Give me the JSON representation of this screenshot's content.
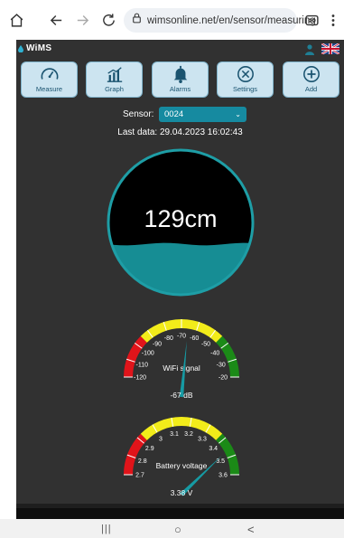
{
  "browser": {
    "url": "wimsonline.net/en/sensor/measuring",
    "icons": [
      "home-icon",
      "back-icon",
      "forward-icon",
      "reload-icon",
      "site-info-icon",
      "tab-switcher-icon",
      "more-menu-icon"
    ]
  },
  "app": {
    "logo": "WiMS",
    "nav": [
      {
        "label": "Measure",
        "icon": "gauge-icon"
      },
      {
        "label": "Graph",
        "icon": "bar-chart-icon"
      },
      {
        "label": "Alarms",
        "icon": "bell-icon"
      },
      {
        "label": "Settings",
        "icon": "tools-icon"
      },
      {
        "label": "Add",
        "icon": "plus-circle-icon"
      }
    ],
    "sensor_label": "Sensor:",
    "sensor_value": "0024",
    "last_data": "Last data: 29.04.2023 16:02:43",
    "level": {
      "text": "129cm",
      "fill_fraction": 0.35
    },
    "wifi_gauge": {
      "title": "WiFi signal",
      "value_text": "-67 dB",
      "value": -67,
      "min": -120,
      "max": -20,
      "ticks": [
        "-120",
        "-110",
        "-100",
        "-90",
        "-80",
        "-70",
        "-60",
        "-50",
        "-40",
        "-30",
        "-20"
      ]
    },
    "battery_gauge": {
      "title": "Battery voltage",
      "value_text": "3.38 V",
      "value": 3.38,
      "min": 2.7,
      "max": 3.6,
      "ticks": [
        "2.7",
        "2.8",
        "2.9",
        "3",
        "3.1",
        "3.2",
        "3.3",
        "3.4",
        "3.5",
        "3.6"
      ]
    },
    "colors": {
      "accent": "#168aa0",
      "red": "#e0141a",
      "yellow": "#f2ec1a",
      "green": "#1b8a17",
      "button_bg": "#cce4f0"
    }
  },
  "android_nav": {
    "recent": "|||",
    "home": "○",
    "back": "<"
  }
}
